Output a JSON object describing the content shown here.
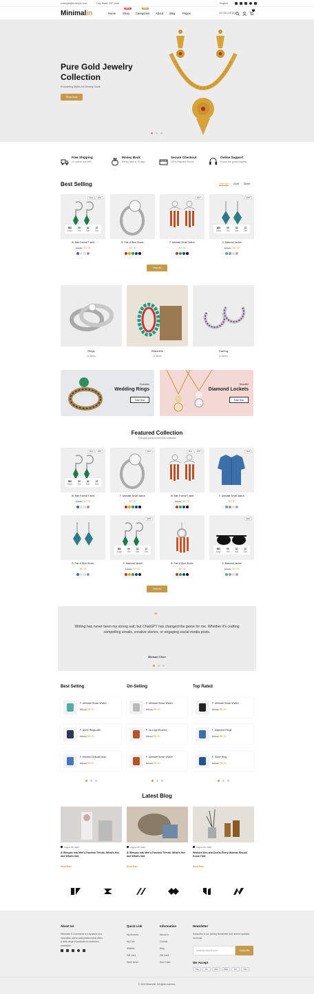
{
  "topbar": {
    "email": "example@example.com",
    "address": "City, State, ZIP Code",
    "language": "English",
    "currency": "US DOLLAR ($)",
    "cart_count": "0"
  },
  "header": {
    "logo_main": "Minimal",
    "logo_accent": "in",
    "nav": [
      {
        "label": "Home",
        "badge": ""
      },
      {
        "label": "Shop",
        "badge": "SALE"
      },
      {
        "label": "Categories",
        "badge": "NEW"
      },
      {
        "label": "About",
        "badge": ""
      },
      {
        "label": "Blog",
        "badge": ""
      },
      {
        "label": "Pages",
        "badge": ""
      }
    ]
  },
  "hero": {
    "title_line1": "Pure Gold Jewelry",
    "title_line2": "Collection",
    "subtitle": "Enchanting Styles for Dreamy Souls.",
    "button": "Shop Now"
  },
  "features": [
    {
      "title": "Free Shipping",
      "sub": "On orders over $99.",
      "icon": "truck-icon"
    },
    {
      "title": "Money Back",
      "sub": "Money back in 15 days.",
      "icon": "money-bag-icon"
    },
    {
      "title": "Secure Checkout",
      "sub": "100% Payment Secure.",
      "icon": "card-icon"
    },
    {
      "title": "Online Support",
      "sub": "Ensure the product quality.",
      "icon": "headset-icon"
    }
  ],
  "best_selling": {
    "title": "Best Selling",
    "tabs": [
      "Diamond",
      "Gold",
      "Silver"
    ],
    "button": "View All",
    "products": [
      {
        "name": "W. Men Formal T-shirt",
        "old": "$70.00",
        "price": "$47.00",
        "tags": [
          "New",
          "-10%"
        ],
        "countdown": [
          "560",
          "00",
          "32",
          "47"
        ]
      },
      {
        "name": "B. Pair of Blue Shoes",
        "old": "",
        "price": "$47.00",
        "tags": [],
        "countdown": []
      },
      {
        "name": "F. Ultimate Smart Watch",
        "old": "",
        "price": "$47.00",
        "tags": [
          "New"
        ],
        "countdown": []
      },
      {
        "name": "S. Maternal Jacket",
        "old": "$75.00",
        "price": "$47.00",
        "tags": [
          "-10%"
        ],
        "countdown": [
          "860",
          "00",
          "32",
          "47"
        ]
      }
    ],
    "cd_labels": [
      "Days",
      "Hrs",
      "Min",
      "Sec"
    ]
  },
  "categories": [
    {
      "name": "Rings",
      "count": "(1 Items)"
    },
    {
      "name": "Bracelets",
      "count": "(1 Items)"
    },
    {
      "name": "Earring",
      "count": "(1 Items)"
    }
  ],
  "banners": [
    {
      "small": "Exclusive",
      "title": "Wedding Rings",
      "button": "Shop Now"
    },
    {
      "small": "Beautiful",
      "title": "Diamond Lockets",
      "button": "Shop Now"
    }
  ],
  "featured": {
    "title": "Featured Collection",
    "subtitle": "Find your product from this collection",
    "button": "View All",
    "products": [
      {
        "name": "W. Men Formal T-shirt",
        "old": "$70.00",
        "price": "$47.00",
        "tags": [
          "New",
          "-10%"
        ],
        "countdown": [
          "560",
          "00",
          "32",
          "47"
        ]
      },
      {
        "name": "F. Ultimate Smart Watch",
        "old": "",
        "price": "$47.00",
        "tags": [
          "New"
        ],
        "countdown": []
      },
      {
        "name": "W. Men Formal T-shirt",
        "old": "$70.00",
        "price": "$47.00",
        "tags": [
          "New",
          "-10%"
        ],
        "countdown": []
      },
      {
        "name": "F. Ultimate Smart Watch",
        "old": "",
        "price": "$47.00",
        "tags": [
          "New"
        ],
        "countdown": []
      },
      {
        "name": "B. Pair of Blue Shoes",
        "old": "",
        "price": "$47.00",
        "tags": [],
        "countdown": []
      },
      {
        "name": "S. Maternal Jacket",
        "old": "$75.00",
        "price": "$47.00",
        "tags": [
          "-10%"
        ],
        "countdown": [
          "860",
          "00",
          "32",
          "47"
        ]
      },
      {
        "name": "B. Pair of Blue Shoes",
        "old": "",
        "price": "$47.00",
        "tags": [],
        "countdown": []
      },
      {
        "name": "S. Maternal Jacket",
        "old": "$75.00",
        "price": "$47.00",
        "tags": [
          "-10%"
        ],
        "countdown": [
          "860",
          "00",
          "32",
          "47"
        ]
      }
    ]
  },
  "testimonial": {
    "quote": "Writing has never been my strong suit, but ChatGPT has changed the game for me. Whether it's crafting compelling emails, creative stories, or engaging social media posts.",
    "author": "Michael Chen"
  },
  "lists": [
    {
      "title": "Best Selling",
      "items": [
        {
          "name": "F. Ultimate Smart Watch",
          "old": "$84.00",
          "price": "$50.00"
        },
        {
          "name": "F. Silver Rings with",
          "old": "$84.00",
          "price": "$50.00"
        },
        {
          "name": "F. Women Delicate Aion",
          "old": "$84.00",
          "price": "$50.00"
        }
      ]
    },
    {
      "title": "On-Selling",
      "items": [
        {
          "name": "F. Ultimate Smart Watch",
          "old": "$84.00",
          "price": "$50.00"
        },
        {
          "name": "F. Va Logo Ercaind",
          "old": "$84.00",
          "price": "$50.00"
        },
        {
          "name": "F. Ultimate Smart Watch",
          "old": "$84.00",
          "price": "$50.00"
        }
      ]
    },
    {
      "title": "Top Rated",
      "items": [
        {
          "name": "F. Ultimate Smart Watch",
          "old": "$84.00",
          "price": "$50.00"
        },
        {
          "name": "F. Diamond Rings",
          "old": "$84.00",
          "price": "$50.00"
        },
        {
          "name": "F. Silver Ring",
          "old": "$84.00",
          "price": "$50.00"
        }
      ]
    }
  ],
  "blog": {
    "title": "Latest Blog",
    "posts": [
      {
        "date": "August 05, 2024",
        "title": "A Glimpse into Men's Fashion Trends: What's Hot and What's Not",
        "more": "Read More"
      },
      {
        "date": "August 05, 2024",
        "title": "A Glimpse into Men's Fashion Trends: What's Hot and What's Not",
        "more": "Read More"
      },
      {
        "date": "August 05, 2024",
        "title": "Fashion Dos and Don'ts Every Woman Should Know That",
        "more": "Read More"
      }
    ]
  },
  "footer": {
    "about_title": "About Us",
    "about_text": "Minimalin E-Commerce is a dynamic and innovative online retail platform that offers a wide range of products to customers worldwide.",
    "quick_title": "Quick Link",
    "quick": [
      "My Account",
      "My Cart",
      "Wishlist",
      "Gift Card",
      "Need Help?"
    ],
    "info_title": "Information",
    "info": [
      "About us",
      "Contact",
      "Blog",
      "Gift Card",
      "Size Chart"
    ],
    "news_title": "Newsletter",
    "news_text": "Subscribe to our weekly Newsletter and receive updates via email.",
    "email_placeholder": "email@example.com",
    "subscribe": "Subscribe",
    "accept_title": "We Accept",
    "payments": [
      "VISA",
      "MC",
      "DISC",
      "AMEX",
      "PAY",
      "VISA"
    ],
    "copyright": "© 2024 Minimalin. All rights reserved."
  },
  "colors": {
    "accent": "#c59a4b",
    "footer_bg": "#efefef"
  }
}
